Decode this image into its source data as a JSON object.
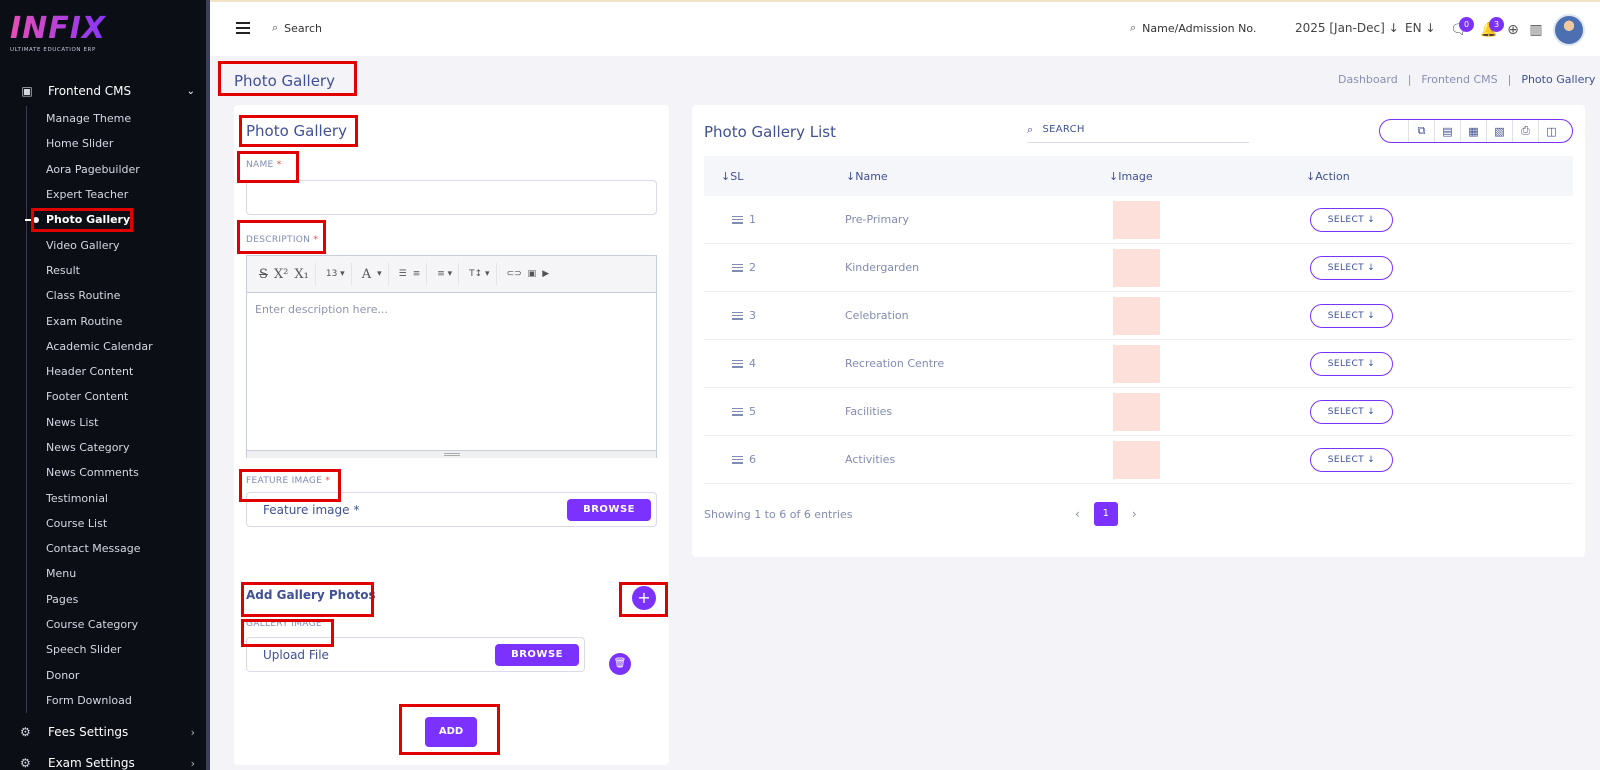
{
  "logo": {
    "brand": "INFIX",
    "tagline": "ULTIMATE EDUCATION ERP"
  },
  "sidebar": {
    "section": "Frontend CMS",
    "items": [
      "Manage Theme",
      "Home Slider",
      "Aora Pagebuilder",
      "Expert Teacher",
      "Photo Gallery",
      "Video Gallery",
      "Result",
      "Class Routine",
      "Exam Routine",
      "Academic Calendar",
      "Header Content",
      "Footer Content",
      "News List",
      "News Category",
      "News Comments",
      "Testimonial",
      "Course List",
      "Contact Message",
      "Menu",
      "Pages",
      "Course Category",
      "Speech Slider",
      "Donor",
      "Form Download"
    ],
    "active_item": "Photo Gallery",
    "bottom": [
      "Fees Settings",
      "Exam Settings"
    ]
  },
  "topbar": {
    "search_label": "Search",
    "admission_search": "Name/Admission No.",
    "session": "2025 [Jan-Dec]",
    "language": "EN",
    "messages_count": "0",
    "notifications_count": "3"
  },
  "page": {
    "title": "Photo Gallery",
    "breadcrumb": [
      "Dashboard",
      "Frontend CMS",
      "Photo Gallery"
    ]
  },
  "form": {
    "title": "Photo Gallery",
    "name_label": "NAME",
    "description_label": "DESCRIPTION",
    "required_mark": "*",
    "editor_font_size": "13",
    "editor_placeholder": "Enter description here...",
    "feature_label": "FEATURE IMAGE",
    "feature_placeholder": "Feature image *",
    "browse": "BROWSE",
    "gallery_title": "Add Gallery Photos",
    "gallery_label": "GALLERY IMAGE",
    "upload_placeholder": "Upload File",
    "add_button": "ADD"
  },
  "list": {
    "title": "Photo Gallery List",
    "search_placeholder": "SEARCH",
    "columns": [
      "SL",
      "Name",
      "Image",
      "Action"
    ],
    "rows": [
      {
        "sl": "1",
        "name": "Pre-Primary"
      },
      {
        "sl": "2",
        "name": "Kindergarden"
      },
      {
        "sl": "3",
        "name": "Celebration"
      },
      {
        "sl": "4",
        "name": "Recreation Centre"
      },
      {
        "sl": "5",
        "name": "Facilities"
      },
      {
        "sl": "6",
        "name": "Activities"
      }
    ],
    "select_label": "SELECT",
    "footer": "Showing 1 to 6 of 6 entries",
    "page": "1"
  },
  "colors": {
    "accent": "#7c32ff",
    "sidebar_bg": "#0c0e16",
    "annotation": "#e00000",
    "thumb": "#fde0d9"
  }
}
